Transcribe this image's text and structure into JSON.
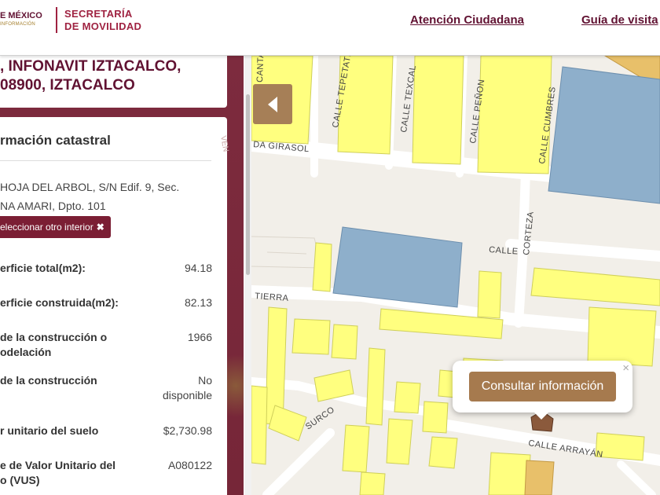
{
  "header": {
    "gov_line1": "E MÉXICO",
    "gov_line2": "INFORMACIÓN",
    "secretaria_line1": "SECRETARÍA",
    "secretaria_line2": "DE MOVILIDAD",
    "nav": [
      "Atención Ciudadana",
      "Guía de visita"
    ]
  },
  "address_card": {
    "title": ", INFONAVIT IZTACALCO,\n08900, IZTACALCO"
  },
  "info": {
    "heading": "rmación catastral",
    "address_detail": "HOJA DEL ARBOL, S/N Edif. 9, Sec.\nNA AMARI, Dpto. 101",
    "change_interior_label": "eleccionar otro interior",
    "rows": [
      {
        "label": "erficie total(m2):",
        "value": "94.18"
      },
      {
        "label": "erficie construida(m2):",
        "value": "82.13"
      },
      {
        "label": "de la construcción o\nodelación",
        "value": "1966"
      },
      {
        "label": "de la construcción",
        "value": "No\ndisponible"
      },
      {
        "label": "r unitario del suelo",
        "value": "$2,730.98"
      },
      {
        "label": "e de Valor Unitario del\no (VUS)",
        "value": "A080122"
      }
    ]
  },
  "map": {
    "streets": [
      "CANTA",
      "CALLE TEPETATE",
      "CALLE TEXCAL",
      "CALLE PEÑON",
      "CALLE CUMBRES",
      "DA GIRASOL",
      "CALLE",
      "CORTEZA",
      "TIERRA",
      "SURCO",
      "CALLE ARRAYÁN"
    ],
    "left_edge_label": "VEN",
    "popup_button": "Consultar información",
    "popup_close": "×",
    "colors": {
      "building_yellow": "#ffff7f",
      "building_blue": "#8eafcb",
      "selected_building": "#8b5a3c",
      "road": "#ffffff",
      "ground": "#f2efe9",
      "accent": "#9f2241"
    }
  }
}
